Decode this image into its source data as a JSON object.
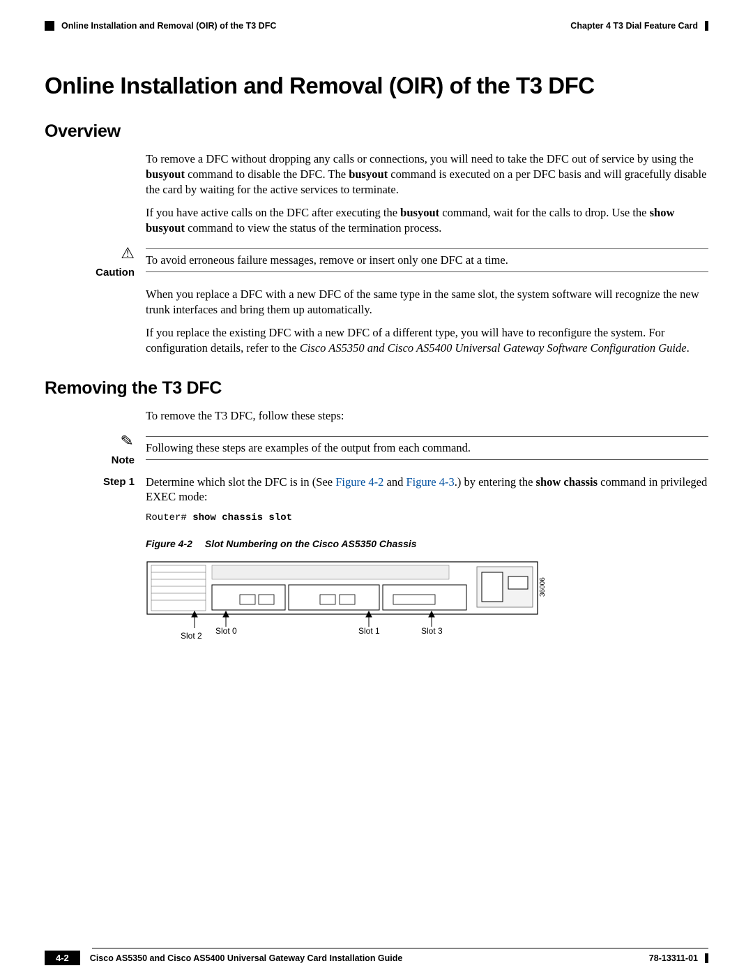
{
  "header": {
    "chapter": "Chapter 4    T3 Dial Feature Card",
    "section": "Online Installation and Removal (OIR) of the T3 DFC"
  },
  "title": "Online Installation and Removal (OIR) of the T3 DFC",
  "overview": {
    "heading": "Overview",
    "p1_a": "To remove a DFC without dropping any calls or connections, you will need to take the DFC out of service by using the ",
    "p1_b": "busyout",
    "p1_c": " command to disable the DFC. The ",
    "p1_d": "busyout",
    "p1_e": " command is executed on a per DFC basis and will gracefully disable the card by waiting for the active services to terminate.",
    "p2_a": "If you have active calls on the DFC after executing the ",
    "p2_b": "busyout",
    "p2_c": " command, wait for the calls to drop. Use the ",
    "p2_d": "show busyout",
    "p2_e": " command to view the status of the termination process.",
    "caution_label": "Caution",
    "caution_text": "To avoid erroneous failure messages, remove or insert only one DFC at a time.",
    "p3": "When you replace a DFC with a new DFC of the same type in the same slot, the system software will recognize the new trunk interfaces and bring them up automatically.",
    "p4_a": "If you replace the existing DFC with a new DFC of a different type, you will have to reconfigure the system. For configuration details, refer to the ",
    "p4_b": "Cisco AS5350 and Cisco AS5400 Universal Gateway Software Configuration Guide",
    "p4_c": "."
  },
  "removing": {
    "heading": "Removing the T3 DFC",
    "intro": "To remove the T3 DFC, follow these steps:",
    "note_label": "Note",
    "note_text": "Following these steps are examples of the output from each command.",
    "step1_label": "Step 1",
    "step1_a": "Determine which slot the DFC is in (See ",
    "step1_link1": "Figure 4-2",
    "step1_b": " and ",
    "step1_link2": "Figure 4-3",
    "step1_c": ".) by entering the ",
    "step1_cmd": "show chassis",
    "step1_d": " command in privileged EXEC mode:",
    "code_prompt": "Router# ",
    "code_cmd": "show chassis slot",
    "fig_num": "Figure 4-2",
    "fig_title": "Slot Numbering on the Cisco AS5350 Chassis",
    "slot_labels": {
      "s0": "Slot 0",
      "s1": "Slot 1",
      "s2": "Slot 2",
      "s3": "Slot 3"
    },
    "fig_id": "36006"
  },
  "footer": {
    "guide": "Cisco AS5350 and Cisco AS5400 Universal Gateway Card Installation Guide",
    "pagenum": "4-2",
    "docid": "78-13311-01"
  }
}
